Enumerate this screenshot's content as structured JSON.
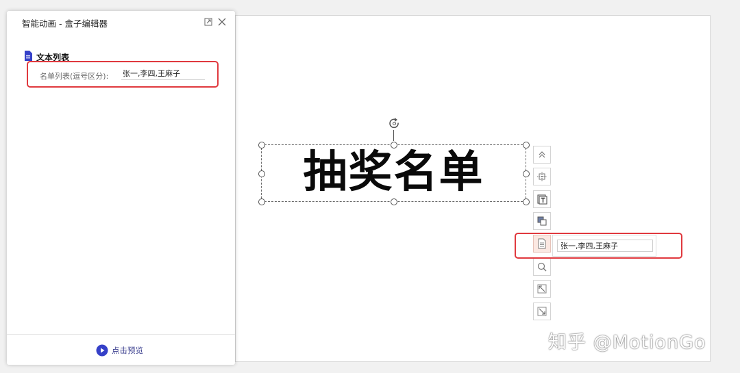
{
  "panel": {
    "title": "智能动画 - 盒子编辑器",
    "section_title": "文本列表",
    "field_label": "名单列表(逗号区分):",
    "field_value": "张一,李四,王麻子",
    "preview_label": "点击预览",
    "restore_icon": "restore-window-icon",
    "close_icon": "close-icon",
    "section_icon": "document-icon",
    "preview_icon": "play-circle-icon"
  },
  "canvas": {
    "headline": "抽奖名单"
  },
  "toolbar": {
    "items": [
      {
        "name": "collapse-up-icon"
      },
      {
        "name": "align-center-icon"
      },
      {
        "name": "text-box-icon"
      },
      {
        "name": "layer-order-icon"
      },
      {
        "name": "text-list-icon",
        "active": true
      },
      {
        "name": "zoom-icon"
      },
      {
        "name": "resize-expand-icon"
      },
      {
        "name": "resize-shrink-icon"
      }
    ],
    "popover_value": "张一,李四,王麻子"
  },
  "watermark": "知乎 @MotionGo",
  "colors": {
    "highlight": "#e0393e",
    "accent": "#3540c8",
    "active_tool_bg": "#fbe8e2"
  }
}
